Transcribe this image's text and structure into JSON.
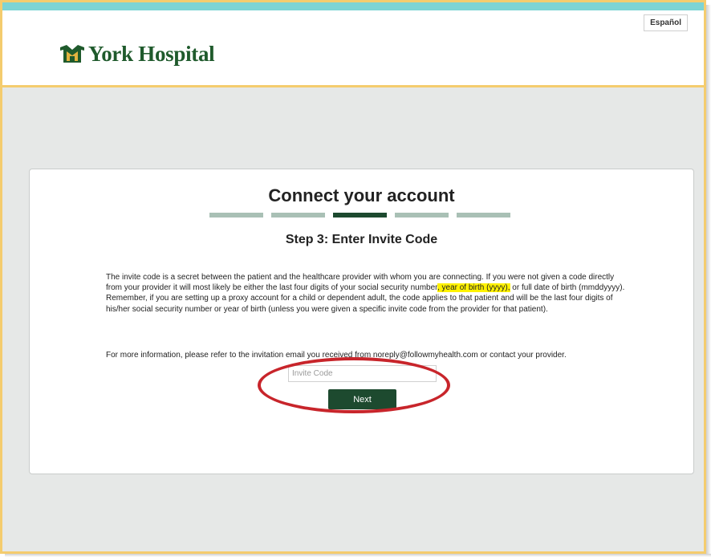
{
  "header": {
    "language_toggle": "Español",
    "logo_text": "York Hospital"
  },
  "card": {
    "title": "Connect your account",
    "steps": {
      "total": 5,
      "current": 3
    },
    "subtitle": "Step 3: Enter Invite Code",
    "paragraph": {
      "before_highlight": "The invite code is a secret between the patient and the healthcare provider with whom you are connecting. If you were not given a code directly from your provider it will most likely be either the last four digits of your social security number",
      "highlight": ", year of birth (yyyy),",
      "after_highlight": " or full date of birth (mmddyyyy). Remember, if you are setting up a proxy account for a child or dependent adult, the code applies to that patient and will be the last four digits of his/her social security number or year of birth (unless you were given a specific invite code from the provider for that patient)."
    },
    "more_info": "For more information, please refer to the invitation email you received from noreply@followmyhealth.com or contact your provider.",
    "invite_input": {
      "placeholder": "Invite Code",
      "value": ""
    },
    "next_button": "Next"
  },
  "colors": {
    "brand_green": "#1d4a2f",
    "accent_border": "#f4cc6e",
    "top_bar": "#7dd4d4",
    "highlight": "#fff200",
    "annotation_circle": "#c8252b"
  }
}
